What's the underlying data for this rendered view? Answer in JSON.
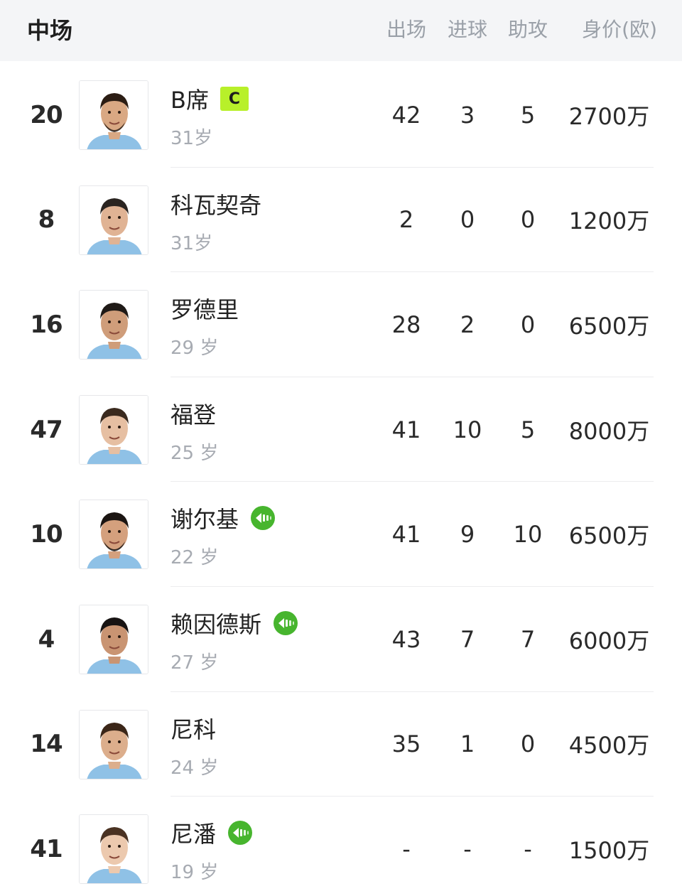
{
  "header": {
    "title": "中场",
    "columns": [
      "出场",
      "进球",
      "助攻",
      "身价(欧)"
    ]
  },
  "colors": {
    "header_bg": "#f4f5f7",
    "captain_badge": "#b8f02a",
    "arrival_icon": "#47b52e",
    "muted_text": "#a7abb2"
  },
  "players": [
    {
      "number": "20",
      "name": "B席",
      "age": "31岁",
      "apps": "42",
      "goals": "3",
      "assists": "5",
      "value": "2700万",
      "badge": "C"
    },
    {
      "number": "8",
      "name": "科瓦契奇",
      "age": "31岁",
      "apps": "2",
      "goals": "0",
      "assists": "0",
      "value": "1200万"
    },
    {
      "number": "16",
      "name": "罗德里",
      "age": "29 岁",
      "apps": "28",
      "goals": "2",
      "assists": "0",
      "value": "6500万"
    },
    {
      "number": "47",
      "name": "福登",
      "age": "25 岁",
      "apps": "41",
      "goals": "10",
      "assists": "5",
      "value": "8000万"
    },
    {
      "number": "10",
      "name": "谢尔基",
      "age": "22 岁",
      "apps": "41",
      "goals": "9",
      "assists": "10",
      "value": "6500万",
      "icon": "arrival-icon"
    },
    {
      "number": "4",
      "name": "赖因德斯",
      "age": "27 岁",
      "apps": "43",
      "goals": "7",
      "assists": "7",
      "value": "6000万",
      "icon": "arrival-icon"
    },
    {
      "number": "14",
      "name": "尼科",
      "age": "24 岁",
      "apps": "35",
      "goals": "1",
      "assists": "0",
      "value": "4500万"
    },
    {
      "number": "41",
      "name": "尼潘",
      "age": "19 岁",
      "apps": "-",
      "goals": "-",
      "assists": "-",
      "value": "1500万",
      "icon": "arrival-icon"
    }
  ]
}
